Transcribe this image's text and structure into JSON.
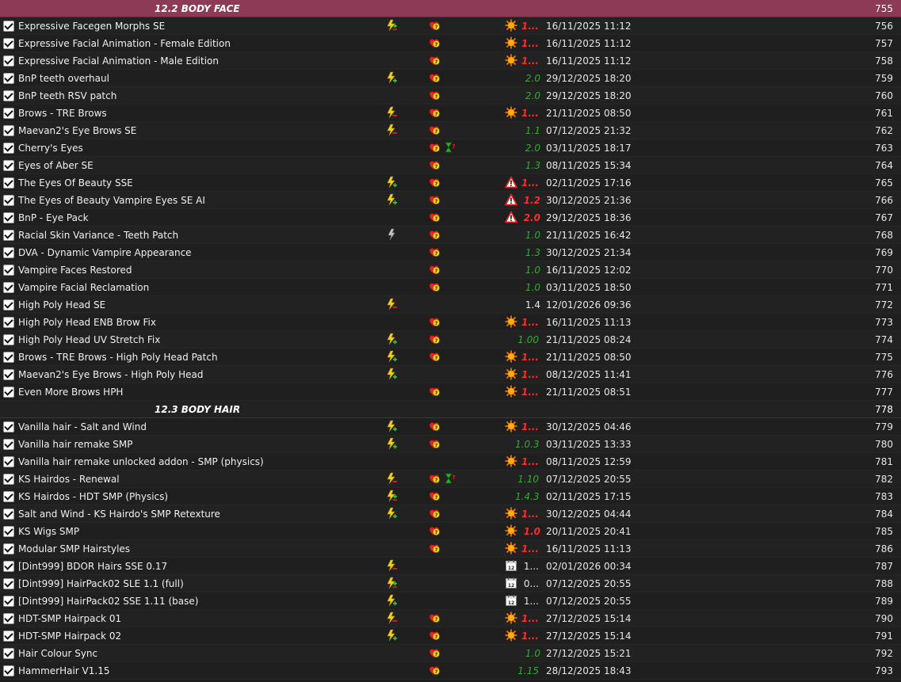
{
  "colors": {
    "separator": "#8c3a55",
    "background": "#1e1e1e",
    "version_ok": "#3aa63a",
    "version_outdated": "#ff2a2a"
  },
  "rows": [
    {
      "kind": "separator",
      "title": "12.2 BODY FACE",
      "priority": "755"
    },
    {
      "kind": "mod",
      "name": "Expressive Facegen Morphs SE",
      "conflict": "conflict-mixed-icon",
      "health": "heart-question-icon",
      "warn": "sun-update-icon",
      "version": "1...",
      "vcolor": "red",
      "date": "16/11/2025 11:12",
      "priority": "756"
    },
    {
      "kind": "mod",
      "name": "Expressive Facial Animation - Female Edition",
      "health": "heart-question-icon",
      "warn": "sun-update-icon",
      "version": "1...",
      "vcolor": "red",
      "date": "16/11/2025 11:12",
      "priority": "757"
    },
    {
      "kind": "mod",
      "name": "Expressive Facial Animation - Male Edition",
      "health": "heart-question-icon",
      "warn": "sun-update-icon",
      "version": "1...",
      "vcolor": "red",
      "date": "16/11/2025 11:12",
      "priority": "758"
    },
    {
      "kind": "mod",
      "name": "BnP teeth overhaul",
      "conflict": "conflict-plus-icon",
      "health": "heart-question-icon",
      "version": "2.0",
      "vcolor": "green",
      "date": "29/12/2025 18:20",
      "priority": "759"
    },
    {
      "kind": "mod",
      "name": "BnP teeth RSV patch",
      "health": "heart-question-icon",
      "version": "2.0",
      "vcolor": "green",
      "date": "29/12/2025 18:20",
      "priority": "760"
    },
    {
      "kind": "mod",
      "name": "Brows - TRE Brows",
      "conflict": "conflict-minus-icon",
      "health": "heart-question-icon",
      "warn": "sun-update-icon",
      "version": "1...",
      "vcolor": "red",
      "date": "21/11/2025 08:50",
      "priority": "761"
    },
    {
      "kind": "mod",
      "name": "Maevan2's Eye Brows SE",
      "conflict": "conflict-minus-icon",
      "health": "heart-question-icon",
      "version": "1.1",
      "vcolor": "green",
      "date": "07/12/2025 21:32",
      "priority": "762"
    },
    {
      "kind": "mod",
      "name": "Cherry's Eyes",
      "health": "heart-question-icon",
      "extra": "hourglass-question-icon",
      "version": "2.0",
      "vcolor": "green",
      "date": "03/11/2025 18:17",
      "priority": "763"
    },
    {
      "kind": "mod",
      "name": "Eyes of Aber SE",
      "health": "heart-question-icon",
      "version": "1.3",
      "vcolor": "green",
      "date": "08/11/2025 15:34",
      "priority": "764"
    },
    {
      "kind": "mod",
      "name": "The Eyes Of Beauty SSE",
      "conflict": "conflict-plus-icon",
      "health": "heart-question-icon",
      "warn": "warning-triangle-icon",
      "version": "1...",
      "vcolor": "red",
      "date": "02/11/2025 17:16",
      "priority": "765"
    },
    {
      "kind": "mod",
      "name": "The Eyes of Beauty Vampire Eyes SE AI",
      "conflict": "conflict-plus-icon",
      "health": "heart-question-icon",
      "warn": "warning-triangle-icon",
      "version": "1.2",
      "vcolor": "red",
      "date": "30/12/2025 21:36",
      "priority": "766"
    },
    {
      "kind": "mod",
      "name": "BnP - Eye Pack",
      "health": "heart-question-icon",
      "warn": "warning-triangle-icon",
      "version": "2.0",
      "vcolor": "red",
      "date": "29/12/2025 18:36",
      "priority": "767"
    },
    {
      "kind": "mod",
      "name": "Racial Skin Variance - Teeth Patch",
      "conflict": "conflict-grey-icon",
      "health": "heart-question-icon",
      "version": "1.0",
      "vcolor": "green",
      "date": "21/11/2025 16:42",
      "priority": "768"
    },
    {
      "kind": "mod",
      "name": "DVA - Dynamic Vampire Appearance",
      "health": "heart-question-icon",
      "version": "1.3",
      "vcolor": "green",
      "date": "30/12/2025 21:34",
      "priority": "769"
    },
    {
      "kind": "mod",
      "name": "Vampire Faces Restored",
      "health": "heart-question-icon",
      "version": "1.0",
      "vcolor": "green",
      "date": "16/11/2025 12:02",
      "priority": "770"
    },
    {
      "kind": "mod",
      "name": "Vampire Facial Reclamation",
      "health": "heart-question-icon",
      "version": "1.0",
      "vcolor": "green",
      "date": "03/11/2025 18:50",
      "priority": "771"
    },
    {
      "kind": "mod",
      "name": "High Poly Head SE",
      "conflict": "conflict-minus-icon",
      "version": "1.4",
      "vcolor": "white",
      "date": "12/01/2026 09:36",
      "priority": "772"
    },
    {
      "kind": "mod",
      "name": "High Poly Head ENB Brow Fix",
      "health": "heart-question-icon",
      "warn": "sun-update-icon",
      "version": "1...",
      "vcolor": "red",
      "date": "16/11/2025 11:13",
      "priority": "773"
    },
    {
      "kind": "mod",
      "name": "High Poly Head UV Stretch Fix",
      "conflict": "conflict-plus-icon",
      "health": "heart-question-icon",
      "version": "1.00",
      "vcolor": "green",
      "date": "21/11/2025 08:24",
      "priority": "774"
    },
    {
      "kind": "mod",
      "name": "Brows - TRE Brows - High Poly Head Patch",
      "conflict": "conflict-plus-icon",
      "health": "heart-question-icon",
      "warn": "sun-update-icon",
      "version": "1...",
      "vcolor": "red",
      "date": "21/11/2025 08:50",
      "priority": "775"
    },
    {
      "kind": "mod",
      "name": "Maevan2's Eye Brows - High Poly Head",
      "conflict": "conflict-plus-icon",
      "warn": "sun-update-icon",
      "version": "1...",
      "vcolor": "red",
      "date": "08/12/2025 11:41",
      "priority": "776"
    },
    {
      "kind": "mod",
      "name": "Even More Brows HPH",
      "health": "heart-question-icon",
      "warn": "sun-update-icon",
      "version": "1...",
      "vcolor": "red",
      "date": "21/11/2025 08:51",
      "priority": "777"
    },
    {
      "kind": "separator",
      "title": "12.3 BODY HAIR",
      "priority": "778"
    },
    {
      "kind": "mod",
      "name": "Vanilla hair - Salt and Wind",
      "conflict": "conflict-plus-icon",
      "health": "heart-question-icon",
      "warn": "sun-update-icon",
      "version": "1...",
      "vcolor": "red",
      "date": "30/12/2025 04:46",
      "priority": "779"
    },
    {
      "kind": "mod",
      "name": "Vanilla hair remake SMP",
      "conflict": "conflict-plus-icon",
      "health": "heart-question-icon",
      "version": "1.0.3",
      "vcolor": "green",
      "date": "03/11/2025 13:33",
      "priority": "780"
    },
    {
      "kind": "mod",
      "name": "Vanilla hair remake unlocked addon - SMP (physics)",
      "warn": "sun-update-icon",
      "version": "1...",
      "vcolor": "red",
      "date": "08/11/2025 12:59",
      "priority": "781"
    },
    {
      "kind": "mod",
      "name": "KS Hairdos - Renewal",
      "conflict": "conflict-minus-icon",
      "health": "heart-question-icon",
      "extra": "hourglass-question-icon",
      "version": "1.10",
      "vcolor": "green",
      "date": "07/12/2025 20:55",
      "priority": "782"
    },
    {
      "kind": "mod",
      "name": "KS Hairdos - HDT SMP (Physics)",
      "conflict": "conflict-mixed-icon",
      "health": "heart-question-icon",
      "version": "1.4.3",
      "vcolor": "green",
      "date": "02/11/2025 17:15",
      "priority": "783"
    },
    {
      "kind": "mod",
      "name": "Salt and Wind - KS Hairdo's SMP Retexture",
      "conflict": "conflict-plus-icon",
      "health": "heart-question-icon",
      "warn": "sun-update-icon",
      "version": "1...",
      "vcolor": "red",
      "date": "30/12/2025 04:44",
      "priority": "784"
    },
    {
      "kind": "mod",
      "name": "KS Wigs SMP",
      "health": "heart-question-icon",
      "warn": "sun-update-icon",
      "version": "1.0",
      "vcolor": "red",
      "date": "20/11/2025 20:41",
      "priority": "785"
    },
    {
      "kind": "mod",
      "name": "Modular SMP Hairstyles",
      "health": "heart-question-icon",
      "warn": "sun-update-icon",
      "version": "1...",
      "vcolor": "red",
      "date": "16/11/2025 11:13",
      "priority": "786"
    },
    {
      "kind": "mod",
      "name": "[Dint999] BDOR Hairs SSE 0.17",
      "conflict": "conflict-minus-icon",
      "warn": "calendar-icon",
      "version": "1...",
      "vcolor": "white",
      "date": "02/01/2026 00:34",
      "priority": "787"
    },
    {
      "kind": "mod",
      "name": "[Dint999] HairPack02 SLE 1.1 (full)",
      "conflict": "conflict-mixed-icon",
      "warn": "calendar-icon",
      "version": "0...",
      "vcolor": "white",
      "date": "07/12/2025 20:55",
      "priority": "788"
    },
    {
      "kind": "mod",
      "name": "[Dint999] HairPack02 SSE 1.11 (base)",
      "conflict": "conflict-plus-icon",
      "warn": "calendar-icon",
      "version": "1...",
      "vcolor": "white",
      "date": "07/12/2025 20:55",
      "priority": "789"
    },
    {
      "kind": "mod",
      "name": "HDT-SMP Hairpack 01",
      "conflict": "conflict-minus-icon",
      "health": "heart-question-icon",
      "warn": "sun-update-icon",
      "version": "1...",
      "vcolor": "red",
      "date": "27/12/2025 15:14",
      "priority": "790"
    },
    {
      "kind": "mod",
      "name": "HDT-SMP Hairpack 02",
      "conflict": "conflict-plus-icon",
      "health": "heart-question-icon",
      "warn": "sun-update-icon",
      "version": "1...",
      "vcolor": "red",
      "date": "27/12/2025 15:14",
      "priority": "791"
    },
    {
      "kind": "mod",
      "name": "Hair Colour Sync",
      "health": "heart-question-icon",
      "version": "1.0",
      "vcolor": "green",
      "date": "27/12/2025 15:21",
      "priority": "792"
    },
    {
      "kind": "mod",
      "name": "HammerHair V1.15",
      "health": "heart-question-icon",
      "version": "1.15",
      "vcolor": "green",
      "date": "28/12/2025 18:43",
      "priority": "793"
    }
  ]
}
